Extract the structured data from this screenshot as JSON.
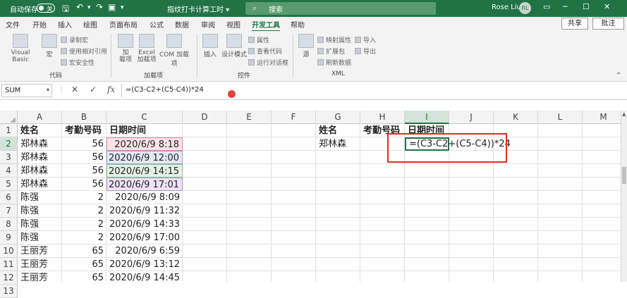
{
  "titlebar": {
    "autosave_label": "自动保存",
    "autosave_state": "关",
    "doc_title": "指纹打卡计算工时 ▾",
    "search_placeholder": "搜索",
    "user_name": "Rose Liu",
    "avatar_initials": "RL",
    "accent": "#217346"
  },
  "tabs": [
    "文件",
    "开始",
    "插入",
    "绘图",
    "页面布局",
    "公式",
    "数据",
    "审阅",
    "视图",
    "开发工具",
    "帮助"
  ],
  "active_tab": "开发工具",
  "share_label": "共享",
  "comment_label": "批注",
  "ribbon": {
    "code": {
      "label": "代码",
      "visual_basic": "Visual Basic",
      "macro": "宏",
      "record": "录制宏",
      "relative": "使用相对引用",
      "security": "宏安全性"
    },
    "addins": {
      "label": "加载项",
      "add": "加\n载项",
      "excel": "Excel\n加载项",
      "com": "COM 加载项"
    },
    "controls": {
      "label": "控件",
      "insert": "插入",
      "design": "设计模式",
      "properties": "属性",
      "view_code": "查看代码",
      "run_dialog": "运行对话框"
    },
    "xml": {
      "label": "XML",
      "source": "源",
      "map_props": "映射属性",
      "expansion": "扩展包",
      "refresh": "刷新数据",
      "import": "导入",
      "export": "导出"
    }
  },
  "formula_bar": {
    "name_box": "SUM",
    "formula": "=(C3-C2+(C5-C4))*24"
  },
  "columns": [
    "A",
    "B",
    "C",
    "D",
    "E",
    "F",
    "G",
    "H",
    "I",
    "J",
    "K",
    "L",
    "M"
  ],
  "selected_column": "I",
  "rows": [
    "1",
    "2",
    "3",
    "4",
    "5",
    "6",
    "7",
    "8",
    "9",
    "10",
    "11",
    "12",
    "13"
  ],
  "selected_row": "2",
  "table": {
    "headers": [
      "姓名",
      "考勤号码",
      "日期时间"
    ],
    "records": [
      [
        "郑林森",
        "56",
        "2020/6/9 8:18"
      ],
      [
        "郑林森",
        "56",
        "2020/6/9 12:00"
      ],
      [
        "郑林森",
        "56",
        "2020/6/9 14:15"
      ],
      [
        "郑林森",
        "56",
        "2020/6/9 17:01"
      ],
      [
        "陈强",
        "2",
        "2020/6/9 8:09"
      ],
      [
        "陈强",
        "2",
        "2020/6/9 11:32"
      ],
      [
        "陈强",
        "2",
        "2020/6/9 14:33"
      ],
      [
        "陈强",
        "2",
        "2020/6/9 17:00"
      ],
      [
        "王丽芳",
        "65",
        "2020/6/9 6:59"
      ],
      [
        "王丽芳",
        "65",
        "2020/6/9 13:12"
      ],
      [
        "王丽芳",
        "65",
        "2020/6/9 14:45"
      ]
    ]
  },
  "summary": {
    "headers": [
      "姓名",
      "考勤号码",
      "日期时间"
    ],
    "name": "郑林森",
    "active_cell_text": "=(C3-C2+(C5-C4))*24"
  }
}
